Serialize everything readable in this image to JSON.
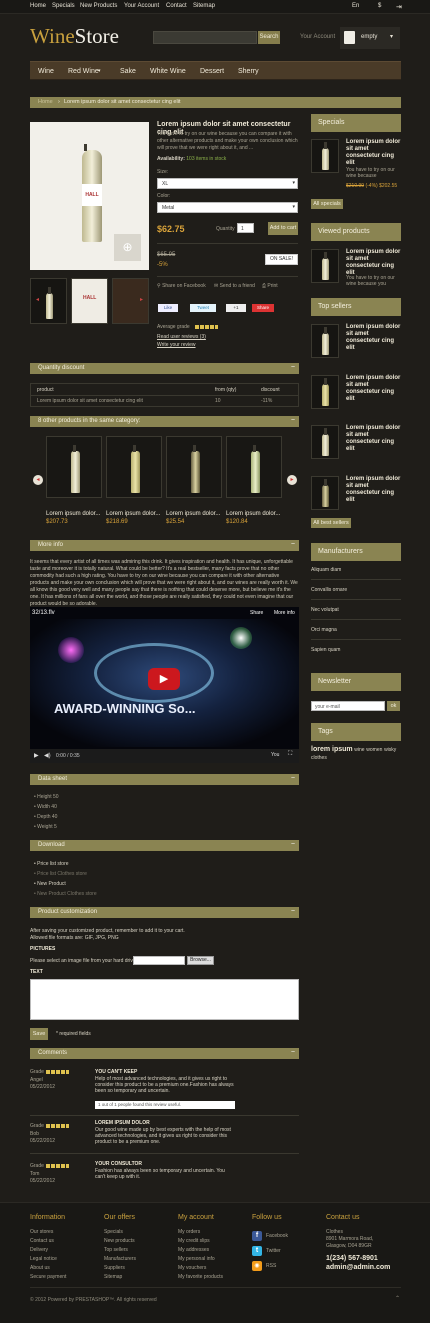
{
  "topbar": {
    "links": [
      "Home",
      "Specials",
      "New Products",
      "Your Account",
      "Contact",
      "Sitemap"
    ],
    "lang": "En",
    "currency": "$"
  },
  "logo": {
    "wine": "Wine",
    "store": "Store"
  },
  "header": {
    "search_button": "Search",
    "account": "Your Account",
    "cart": "empty"
  },
  "nav": [
    "Wine",
    "Red Wine",
    "Sake",
    "White Wine",
    "Dessert",
    "Sherry"
  ],
  "breadcrumb": {
    "home": "Home",
    "current": "Lorem ipsum dolor sit amet consectetur cing elit"
  },
  "product": {
    "title": "Lorem ipsum dolor sit amet consectetur cing elit",
    "desc": "You have to try on our wine because you can compare it with other alternative products and make your own conclusion which will prove that we were right about it, and ...",
    "availability_label": "Availability:",
    "availability": "103 items in stock",
    "size_label": "Size:",
    "size": "XL",
    "color_label": "Color:",
    "color": "Metal",
    "price": "$62.75",
    "qty_label": "Quantity",
    "qty": "1",
    "add_to_cart": "Add to cart",
    "old_price": "$65.95",
    "discount": "-5%",
    "on_sale": "ON SALE!",
    "share": "Share on Facebook",
    "send": "Send to a friend",
    "print": "Print",
    "average": "Average grade",
    "read_reviews": "Read user reviews (3)",
    "write_review": "Write your review",
    "social": [
      "Like",
      "Tweet",
      "+1",
      "Share"
    ],
    "thumb_labels": [
      "HALL",
      "HALL"
    ]
  },
  "quantity_discount": {
    "title": "Quantity discount",
    "headers": [
      "product",
      "from (qty)",
      "discount"
    ],
    "row": [
      "Lorem ipsum dolor sit amet consectetur cing elit",
      "10",
      "-11%"
    ]
  },
  "other_products": {
    "title": "8 other products in the same category:",
    "items": [
      {
        "name": "Lorem ipsum dolor...",
        "price": "$207.73"
      },
      {
        "name": "Lorem ipsum dolor...",
        "price": "$218.69"
      },
      {
        "name": "Lorem ipsum dolor...",
        "price": "$25.54"
      },
      {
        "name": "Lorem ipsum dolor...",
        "price": "$120.84"
      }
    ]
  },
  "more_info": {
    "title": "More info",
    "text": "It seems that every artist of all times was admiring this drink. It gives inspiration and health. It has unique, unforgettable taste and moreover it is totally natural. What could be better? It's a real bestseller, many facts prove that no other commodity had such a high rating. You have to try on our wine because you can compare it with other alternative products and make your own conclusion which will prove that we were right about it, and our wines are really worth it. We all know this good very well and many people say that there is nothing that could deserve more, but believe me it's the one. It has millions of fans all over the world, and those people are really satisfied, they could not even imagine that our product would be so adorable.",
    "video_title": "32/13.flv",
    "share": "Share",
    "more_info": "More info",
    "video_text": "AWARD-WINNING So...",
    "time": "0:00 / 0:35"
  },
  "data_sheet": {
    "title": "Data sheet",
    "items": [
      "Height 50",
      "Width 40",
      "Depth 40",
      "Weight 5"
    ]
  },
  "download": {
    "title": "Download",
    "items": [
      "Price list store",
      "Price list Clothes store",
      "New Product",
      "New Product Clothes store"
    ]
  },
  "customization": {
    "title": "Product customization",
    "p1": "After saving your customized product, remember to add it to your cart.",
    "p2": "Allowed file formats are: GIF, JPG, PNG",
    "pictures": "PICTURES",
    "file_label": "Please select an image file from your hard drive:",
    "browse": "Browse...",
    "text": "TEXT",
    "save": "Save",
    "required": "* required fields"
  },
  "comments": {
    "title": "Comments",
    "grade": "Grade",
    "items": [
      {
        "author": "Angel",
        "date": "05/22/2012",
        "title": "YOU CAN'T KEEP",
        "body": "Help of most advanced technologies, and it gives us right to consider this product to be a premium one.Fashion has always been so temporary and uncertain.",
        "helpful": "1 out of 1 people found this review useful."
      },
      {
        "author": "Bob",
        "date": "05/22/2012",
        "title": "LOREM IPSUM DOLOR",
        "body": "Our good wine made up by best experts with the help of most advanced technologies, and it gives us right to consider this product to be a premium one.",
        "helpful": ""
      },
      {
        "author": "Tom",
        "date": "05/22/2012",
        "title": "YOUR CONSULTOR",
        "body": "Fashion has always been so temporary and uncertain. You can't keep up with it.",
        "helpful": ""
      }
    ]
  },
  "sidebar": {
    "specials": {
      "title": "Specials",
      "name": "Lorem ipsum dolor sit amet consectetur cing elit",
      "desc": "You have to try on our wine because",
      "old": "$210.99",
      "pct": "(-4%)",
      "price": "$202.55",
      "btn": "All specials"
    },
    "viewed": {
      "title": "Viewed products",
      "name": "Lorem ipsum dolor sit amet consectetur cing elit",
      "desc": "You have to try on our wine because you"
    },
    "top": {
      "title": "Top sellers",
      "items": [
        "Lorem ipsum dolor sit amet consectetur cing elit",
        "Lorem ipsum dolor sit amet consectetur cing elit",
        "Lorem ipsum dolor sit amet consectetur cing elit",
        "Lorem ipsum dolor sit amet consectetur cing elit"
      ],
      "btn": "All best sellers"
    },
    "manufacturers": {
      "title": "Manufacturers",
      "items": [
        "Aliquam diam",
        "Convallis ornare",
        "Nec volutpat",
        "Orci magna",
        "Sapien quam"
      ]
    },
    "newsletter": {
      "title": "Newsletter",
      "placeholder": "your e-mail",
      "btn": "ok"
    },
    "tags": {
      "title": "Tags",
      "items": [
        "lorem ipsum",
        "wine",
        "women",
        "wisky",
        "clothes"
      ]
    }
  },
  "footer": {
    "cols": [
      {
        "title": "Information",
        "items": [
          "Our stores",
          "Contact us",
          "Delivery",
          "Legal notice",
          "About us",
          "Secure payment"
        ]
      },
      {
        "title": "Our offers",
        "items": [
          "Specials",
          "New products",
          "Top sellers",
          "Manufacturers",
          "Suppliers",
          "Sitemap"
        ]
      },
      {
        "title": "My account",
        "items": [
          "My orders",
          "My credit slips",
          "My addresses",
          "My personal info",
          "My vouchers",
          "My favorite products"
        ]
      },
      {
        "title": "Follow us",
        "items": [
          "Facebook",
          "Twitter",
          "RSS"
        ]
      },
      {
        "title": "Contact us",
        "items": [
          "Clothes",
          "8901 Marmora Road,",
          "Glasgow, D04 89GR",
          "1(234) 567-8901",
          "admin@admin.com"
        ]
      }
    ],
    "copyright": "© 2012 Powered by PRESTASHOP™. All rights reserved"
  },
  "colors": {
    "accent": "#8a8452",
    "bg": "#1f1d19",
    "gold": "#c9a13e",
    "price": "#d9a33a"
  }
}
